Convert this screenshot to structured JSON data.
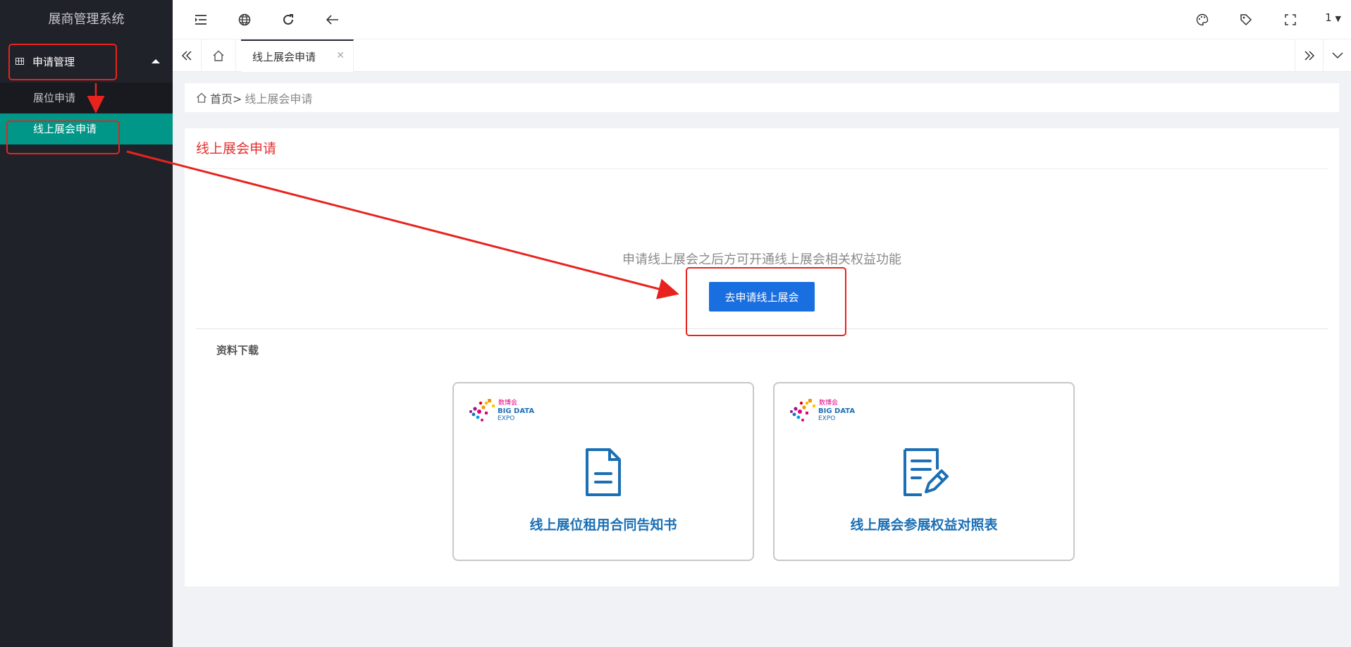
{
  "app": {
    "title": "展商管理系统"
  },
  "sidebar": {
    "group_label": "申请管理",
    "items": [
      {
        "label": "展位申请",
        "active": false
      },
      {
        "label": "线上展会申请",
        "active": true
      }
    ]
  },
  "header": {
    "icons": [
      "menu-collapse-icon",
      "globe-icon",
      "refresh-icon",
      "back-arrow-icon",
      "palette-icon",
      "tag-icon",
      "fullscreen-icon"
    ],
    "user_label": "1"
  },
  "tabs": {
    "active_tab": "线上展会申请"
  },
  "breadcrumb": {
    "home": "首页>",
    "current": "线上展会申请"
  },
  "main": {
    "title": "线上展会申请",
    "notice": "申请线上展会之后方可开通线上展会相关权益功能",
    "apply_button": "去申请线上展会",
    "downloads_label": "资料下载",
    "cards": [
      {
        "title": "线上展位租用合同告知书",
        "icon": "document-icon"
      },
      {
        "title": "线上展会参展权益对照表",
        "icon": "edit-document-icon"
      }
    ],
    "logo": {
      "line1": "数博会",
      "line2": "BIG DATA",
      "line3": "EXPO"
    }
  },
  "colors": {
    "sidebar_bg": "#20222a",
    "active_menu": "#009688",
    "primary_button": "#1a6fe0",
    "title_red": "#e52f2f",
    "card_title_blue": "#1a6fb5",
    "annotation_red": "#e8231e"
  }
}
